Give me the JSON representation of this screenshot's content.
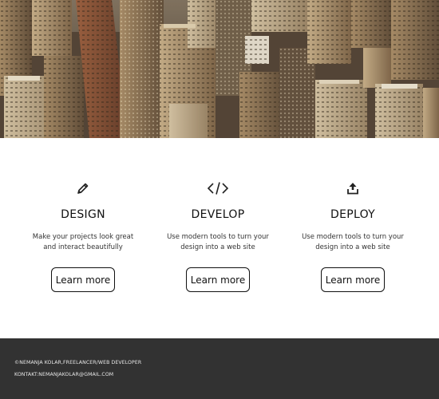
{
  "features": [
    {
      "icon": "pencil-icon",
      "title": "DESIGN",
      "desc_line1": "Make your projects look great",
      "desc_line2": "and interact beautifully",
      "button": "Learn more"
    },
    {
      "icon": "code-icon",
      "title": "DEVELOP",
      "desc_line1": "Use modern tools to turn your",
      "desc_line2": "design into a web site",
      "button": "Learn more"
    },
    {
      "icon": "upload-icon",
      "title": "DEPLOY",
      "desc_line1": "Use modern tools to turn your",
      "desc_line2": "design into a web site",
      "button": "Learn more"
    }
  ],
  "footer": {
    "copyright": "©NEMANJA KOLAR,FREELANCER/WEB DEVELOPER",
    "contact": "KONTAKT:NEMANJAKOLAR@GMAIL.COM"
  },
  "colors": {
    "footer_bg": "#323232",
    "text": "#111111",
    "hero_tone": "#8a7a66"
  }
}
